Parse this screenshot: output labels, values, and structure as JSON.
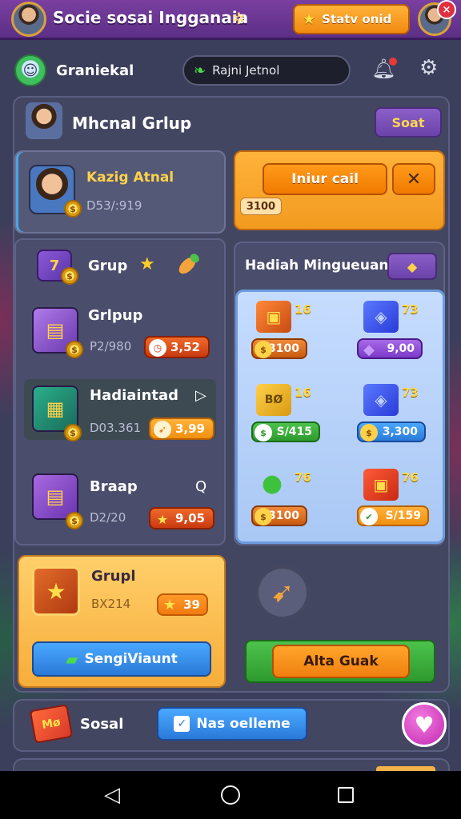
{
  "header": {
    "title": "Socie sosai Ingganaia",
    "status_button": "Statv onid",
    "notification_badge": "×"
  },
  "userbar": {
    "username": "Graniekal",
    "search_placeholder": "Rajni Jetnol"
  },
  "main": {
    "title": "Mhcnal Grlup",
    "sort_label": "Soat",
    "profile": {
      "name": "Kazig Atnal",
      "sub": "D53/:919"
    },
    "claim_card": {
      "claim_label": "Iniur cail",
      "close_label": "✕",
      "value": "3100"
    },
    "group_list": {
      "title": "Grup",
      "items": [
        {
          "name": "Grlpup",
          "sub": "P2/980",
          "price": "3,52"
        },
        {
          "name": "Hadiaintad",
          "sub": "D03.361",
          "price": "3,99"
        },
        {
          "name": "Braap",
          "sub": "D2/20",
          "price": "9,05"
        }
      ]
    },
    "weekly_reward": {
      "title": "Hadiah Mingueuan",
      "items": [
        {
          "num": "16",
          "price": "3100"
        },
        {
          "num": "73",
          "price": "9,00"
        },
        {
          "num": "16",
          "price": "S/415"
        },
        {
          "num": "73",
          "price": "3,300"
        },
        {
          "num": "76",
          "price": "3100"
        },
        {
          "num": "76",
          "price": "S/159"
        }
      ]
    },
    "gold_card": {
      "title": "Grupl",
      "sub": "BX214",
      "price": "39",
      "button_label": "SengiViaunt"
    },
    "action_button": "Alta Guak"
  },
  "social": {
    "label": "Sosal",
    "icon_text": "Mø",
    "invite_label": "Nas oelleme"
  },
  "colors": {
    "top_bar": "#6a36a0",
    "panel": "#434661",
    "accent_orange": "#f29a20",
    "accent_blue": "#2a7ad8",
    "accent_green": "#2e9a2e",
    "reward_grid": "#b4d0fa"
  },
  "icons": {
    "status": "star-icon",
    "notification": "bell-icon",
    "settings": "gear-icon",
    "weekly_reward": "diamond-icon",
    "heart": "heart-icon"
  }
}
